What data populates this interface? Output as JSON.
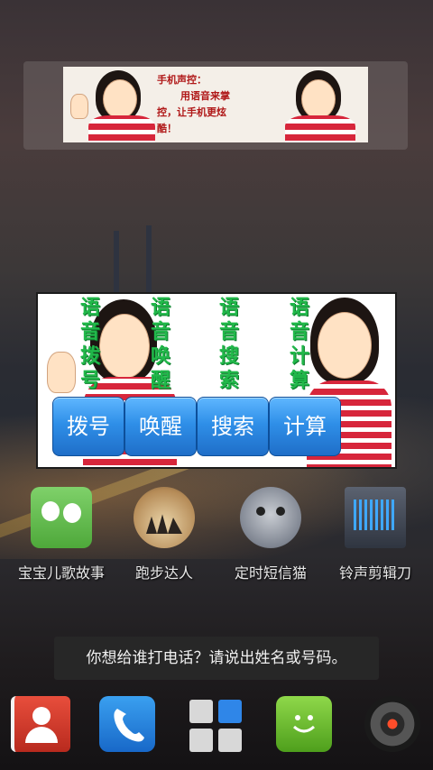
{
  "banner": {
    "lines": [
      "手机声控：",
      "用语音来掌",
      "控，让手机更炫",
      "酷！"
    ]
  },
  "voice_widget": {
    "columns": [
      [
        "语",
        "音",
        "拨",
        "号"
      ],
      [
        "语",
        "音",
        "唤",
        "醒"
      ],
      [
        "语",
        "音",
        "搜",
        "索"
      ],
      [
        "语",
        "音",
        "计",
        "算"
      ]
    ],
    "buttons": [
      "拨号",
      "唤醒",
      "搜索",
      "计算"
    ]
  },
  "apps": [
    {
      "label": "宝宝儿歌故事",
      "icon": "kids-songs-icon"
    },
    {
      "label": "跑步达人",
      "icon": "running-icon"
    },
    {
      "label": "定时短信猫",
      "icon": "sms-cat-icon"
    },
    {
      "label": "铃声剪辑刀",
      "icon": "ringtone-cutter-icon"
    }
  ],
  "toast": {
    "text": "你想给谁打电话？请说出姓名或号码。"
  },
  "dock": [
    {
      "icon": "contacts-icon"
    },
    {
      "icon": "phone-icon"
    },
    {
      "icon": "app-drawer-icon"
    },
    {
      "icon": "messaging-icon"
    },
    {
      "icon": "camera-icon"
    }
  ]
}
